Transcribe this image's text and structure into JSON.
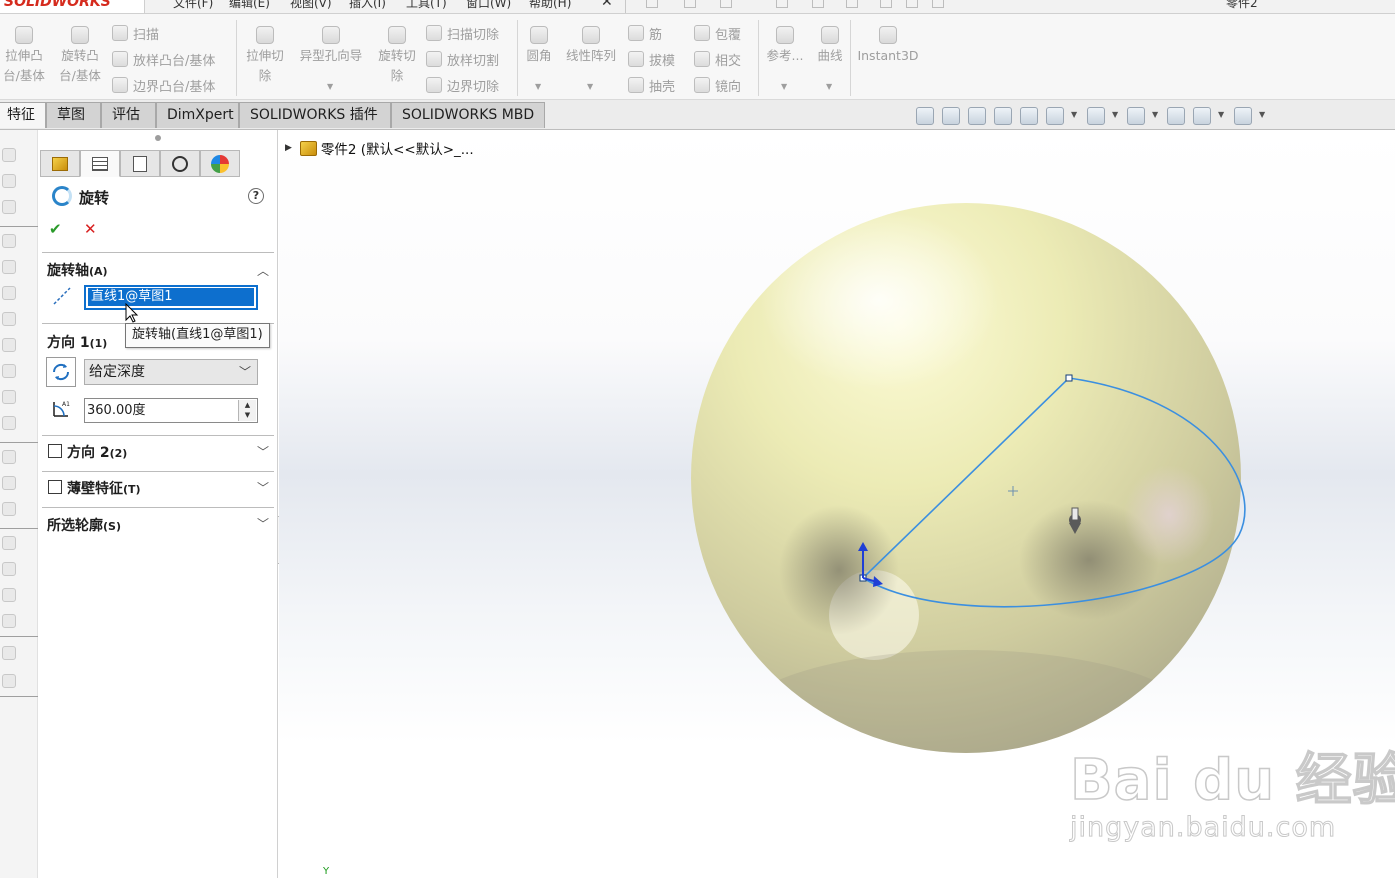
{
  "app": {
    "brand": "SOLIDWORKS",
    "menus": [
      "文件(F)",
      "编辑(E)",
      "视图(V)",
      "插入(I)",
      "工具(T)",
      "窗口(W)",
      "帮助(H)"
    ],
    "close_glyph": "✕",
    "document_title": "零件2"
  },
  "features_toolbar": {
    "extrude_boss": [
      "拉伸凸",
      "台/基体"
    ],
    "revolve_boss": [
      "旋转凸",
      "台/基体"
    ],
    "sweep": "扫描",
    "loft_boss": "放样凸台/基体",
    "boundary_boss": "边界凸台/基体",
    "extrude_cut": [
      "拉伸切",
      "除"
    ],
    "hole_wizard": "异型孔向导",
    "revolve_cut": [
      "旋转切",
      "除"
    ],
    "swept_cut": "扫描切除",
    "lofted_cut": "放样切割",
    "boundary_cut": "边界切除",
    "fillet": "圆角",
    "linear_pattern": "线性阵列",
    "rib": "筋",
    "draft": "拔模",
    "shell": "抽壳",
    "wrap": "包覆",
    "intersect": "相交",
    "mirror": "镜向",
    "reference": "参考...",
    "curves": "曲线",
    "instant3d": "Instant3D"
  },
  "tabs": [
    "特征",
    "草图",
    "评估",
    "DimXpert",
    "SOLIDWORKS 插件",
    "SOLIDWORKS MBD"
  ],
  "active_tab": "特征",
  "view_toolbar_icons": [
    "zoom-to-fit-icon",
    "zoom-to-area-icon",
    "previous-view-icon",
    "section-view-icon",
    "dynamic-annotation-icon",
    "view-orientation-icon",
    "display-style-icon",
    "hide-show-items-icon",
    "edit-appearance-icon",
    "apply-scene-icon",
    "view-settings-icon"
  ],
  "property_manager": {
    "tab_icons": [
      "feature-manager-icon",
      "property-manager-icon",
      "configuration-manager-icon",
      "dimxpert-manager-icon",
      "display-manager-icon"
    ],
    "title": "旋转",
    "help": "?",
    "ok": "✔",
    "cancel": "✕",
    "axis_section": {
      "title": "旋转轴",
      "key": "(A)",
      "value": "直线1@草图1"
    },
    "tooltip": "旋转轴(直线1@草图1)",
    "direction1": {
      "title": "方向 1",
      "key": "(1)",
      "end_condition": "给定深度",
      "angle": "360.00度"
    },
    "direction2": {
      "title": "方向 2",
      "key": "(2)",
      "checked": false
    },
    "thin_feature": {
      "title": "薄壁特征",
      "key": "(T)",
      "checked": false
    },
    "selected_contours": {
      "title": "所选轮廓",
      "key": "(S)"
    }
  },
  "feature_tree": {
    "root_label": "零件2 (默认<<默认>_..."
  },
  "colors": {
    "sphere_highlight": "#fcfbd6",
    "sphere_base": "#c5c296",
    "sphere_shadow": "#9b9884",
    "sketch_line": "#3b8fe0",
    "selection_blue": "#0d6fce",
    "triad_blue": "#1f3fd6",
    "logo_red": "#d52b1e"
  },
  "watermark": {
    "logo": "Bai du 经验",
    "url": "jingyan.baidu.com"
  },
  "triad_label": "Y"
}
